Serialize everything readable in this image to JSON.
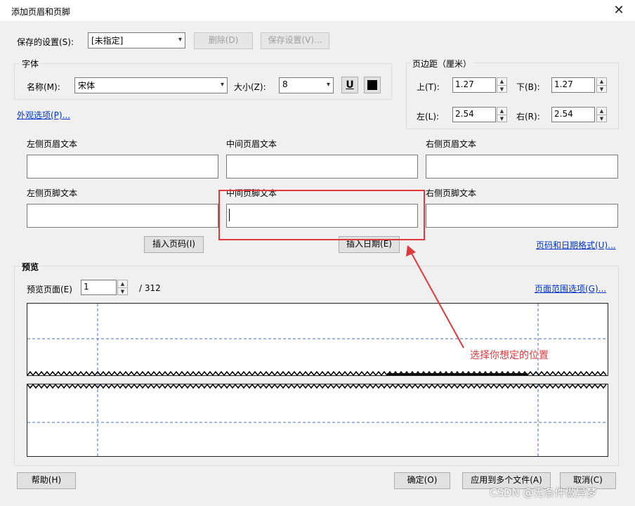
{
  "window": {
    "title": "添加页眉和页脚",
    "close_glyph": "✕"
  },
  "saved_settings": {
    "label": "保存的设置(S):",
    "value": "[未指定]",
    "delete_label": "删除(D)",
    "save_label": "保存设置(V)..."
  },
  "font": {
    "group_title": "字体",
    "name_label": "名称(M):",
    "name_value": "宋体",
    "size_label": "大小(Z):",
    "size_value": "8",
    "underline_glyph": "U",
    "color": "#000000"
  },
  "appearance_link": "外观选项(P)...",
  "margins": {
    "group_title": "页边距（厘米）",
    "top_label": "上(T):",
    "top_value": "1.27",
    "bottom_label": "下(B):",
    "bottom_value": "1.27",
    "left_label": "左(L):",
    "left_value": "2.54",
    "right_label": "右(R):",
    "right_value": "2.54"
  },
  "header_footer": {
    "left_header_label": "左侧页眉文本",
    "center_header_label": "中间页眉文本",
    "right_header_label": "右侧页眉文本",
    "left_footer_label": "左侧页脚文本",
    "center_footer_label": "中间页脚文本",
    "right_footer_label": "右侧页脚文本",
    "left_header_value": "",
    "center_header_value": "",
    "right_header_value": "",
    "left_footer_value": "",
    "center_footer_value": "",
    "right_footer_value": ""
  },
  "insert": {
    "page_number_label": "插入页码(I)",
    "date_label": "插入日期(E)",
    "format_link": "页码和日期格式(U)..."
  },
  "preview": {
    "group_title": "预览",
    "page_label": "预览页面(E)",
    "page_value": "1",
    "page_total": "/ 312",
    "range_link": "页面范围选项(G)..."
  },
  "annotation": {
    "text": "选择你想定的位置",
    "color": "#e0393b"
  },
  "footer_buttons": {
    "help_label": "帮助(H)",
    "ok_label": "确定(O)",
    "apply_multi_label": "应用到多个文件(A)",
    "cancel_label": "取消(C)"
  },
  "watermark": "CSDN @无条件做异梦"
}
